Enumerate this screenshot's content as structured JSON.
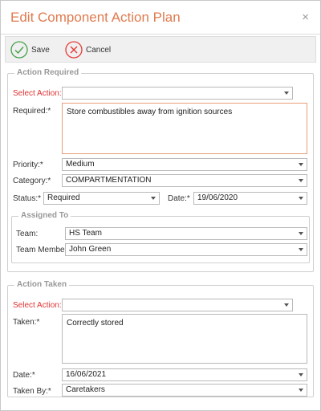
{
  "dialog": {
    "title": "Edit Component Action Plan",
    "close_glyph": "×"
  },
  "toolbar": {
    "save_label": "Save",
    "cancel_label": "Cancel",
    "save_icon": "check-circle-icon",
    "cancel_icon": "x-circle-icon"
  },
  "action_required": {
    "legend": "Action Required",
    "select_action_label": "Select Action:",
    "select_action_value": "",
    "required_label": "Required:*",
    "required_value": "Store combustibles away from ignition sources",
    "priority_label": "Priority:*",
    "priority_value": "Medium",
    "category_label": "Category:*",
    "category_value": "COMPARTMENTATION",
    "status_label": "Status:*",
    "status_value": "Required",
    "date_label": "Date:*",
    "date_value": "19/06/2020",
    "assigned_to": {
      "legend": "Assigned To",
      "team_label": "Team:",
      "team_value": "HS Team",
      "member_label": "Team Member:",
      "member_value": "John Green"
    }
  },
  "action_taken": {
    "legend": "Action Taken",
    "select_action_label": "Select Action:",
    "select_action_value": "",
    "taken_label": "Taken:*",
    "taken_value": "Correctly stored",
    "date_label": "Date:*",
    "date_value": "16/06/2021",
    "taken_by_label": "Taken By:*",
    "taken_by_value": "Caretakers"
  },
  "colors": {
    "title": "#e07b4f",
    "required_label": "#e03131",
    "save_icon": "#43a047",
    "cancel_icon": "#e53935"
  }
}
